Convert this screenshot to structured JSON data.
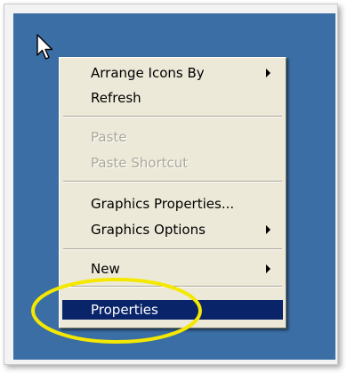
{
  "context_menu": {
    "items": [
      {
        "label": "Arrange Icons By",
        "submenu": true,
        "enabled": true
      },
      {
        "label": "Refresh",
        "submenu": false,
        "enabled": true
      },
      {
        "label": "Paste",
        "submenu": false,
        "enabled": false
      },
      {
        "label": "Paste Shortcut",
        "submenu": false,
        "enabled": false
      },
      {
        "label": "Graphics Properties...",
        "submenu": false,
        "enabled": true
      },
      {
        "label": "Graphics Options",
        "submenu": true,
        "enabled": true
      },
      {
        "label": "New",
        "submenu": true,
        "enabled": true
      },
      {
        "label": "Properties",
        "submenu": false,
        "enabled": true,
        "selected": true
      }
    ]
  },
  "colors": {
    "desktop": "#3a6ea5",
    "menu_background": "#ece9d8",
    "selection": "#0a246a",
    "highlight_ellipse": "#f5e800"
  },
  "icons": {
    "cursor": "mouse-pointer-icon",
    "submenu": "submenu-arrow-icon"
  }
}
